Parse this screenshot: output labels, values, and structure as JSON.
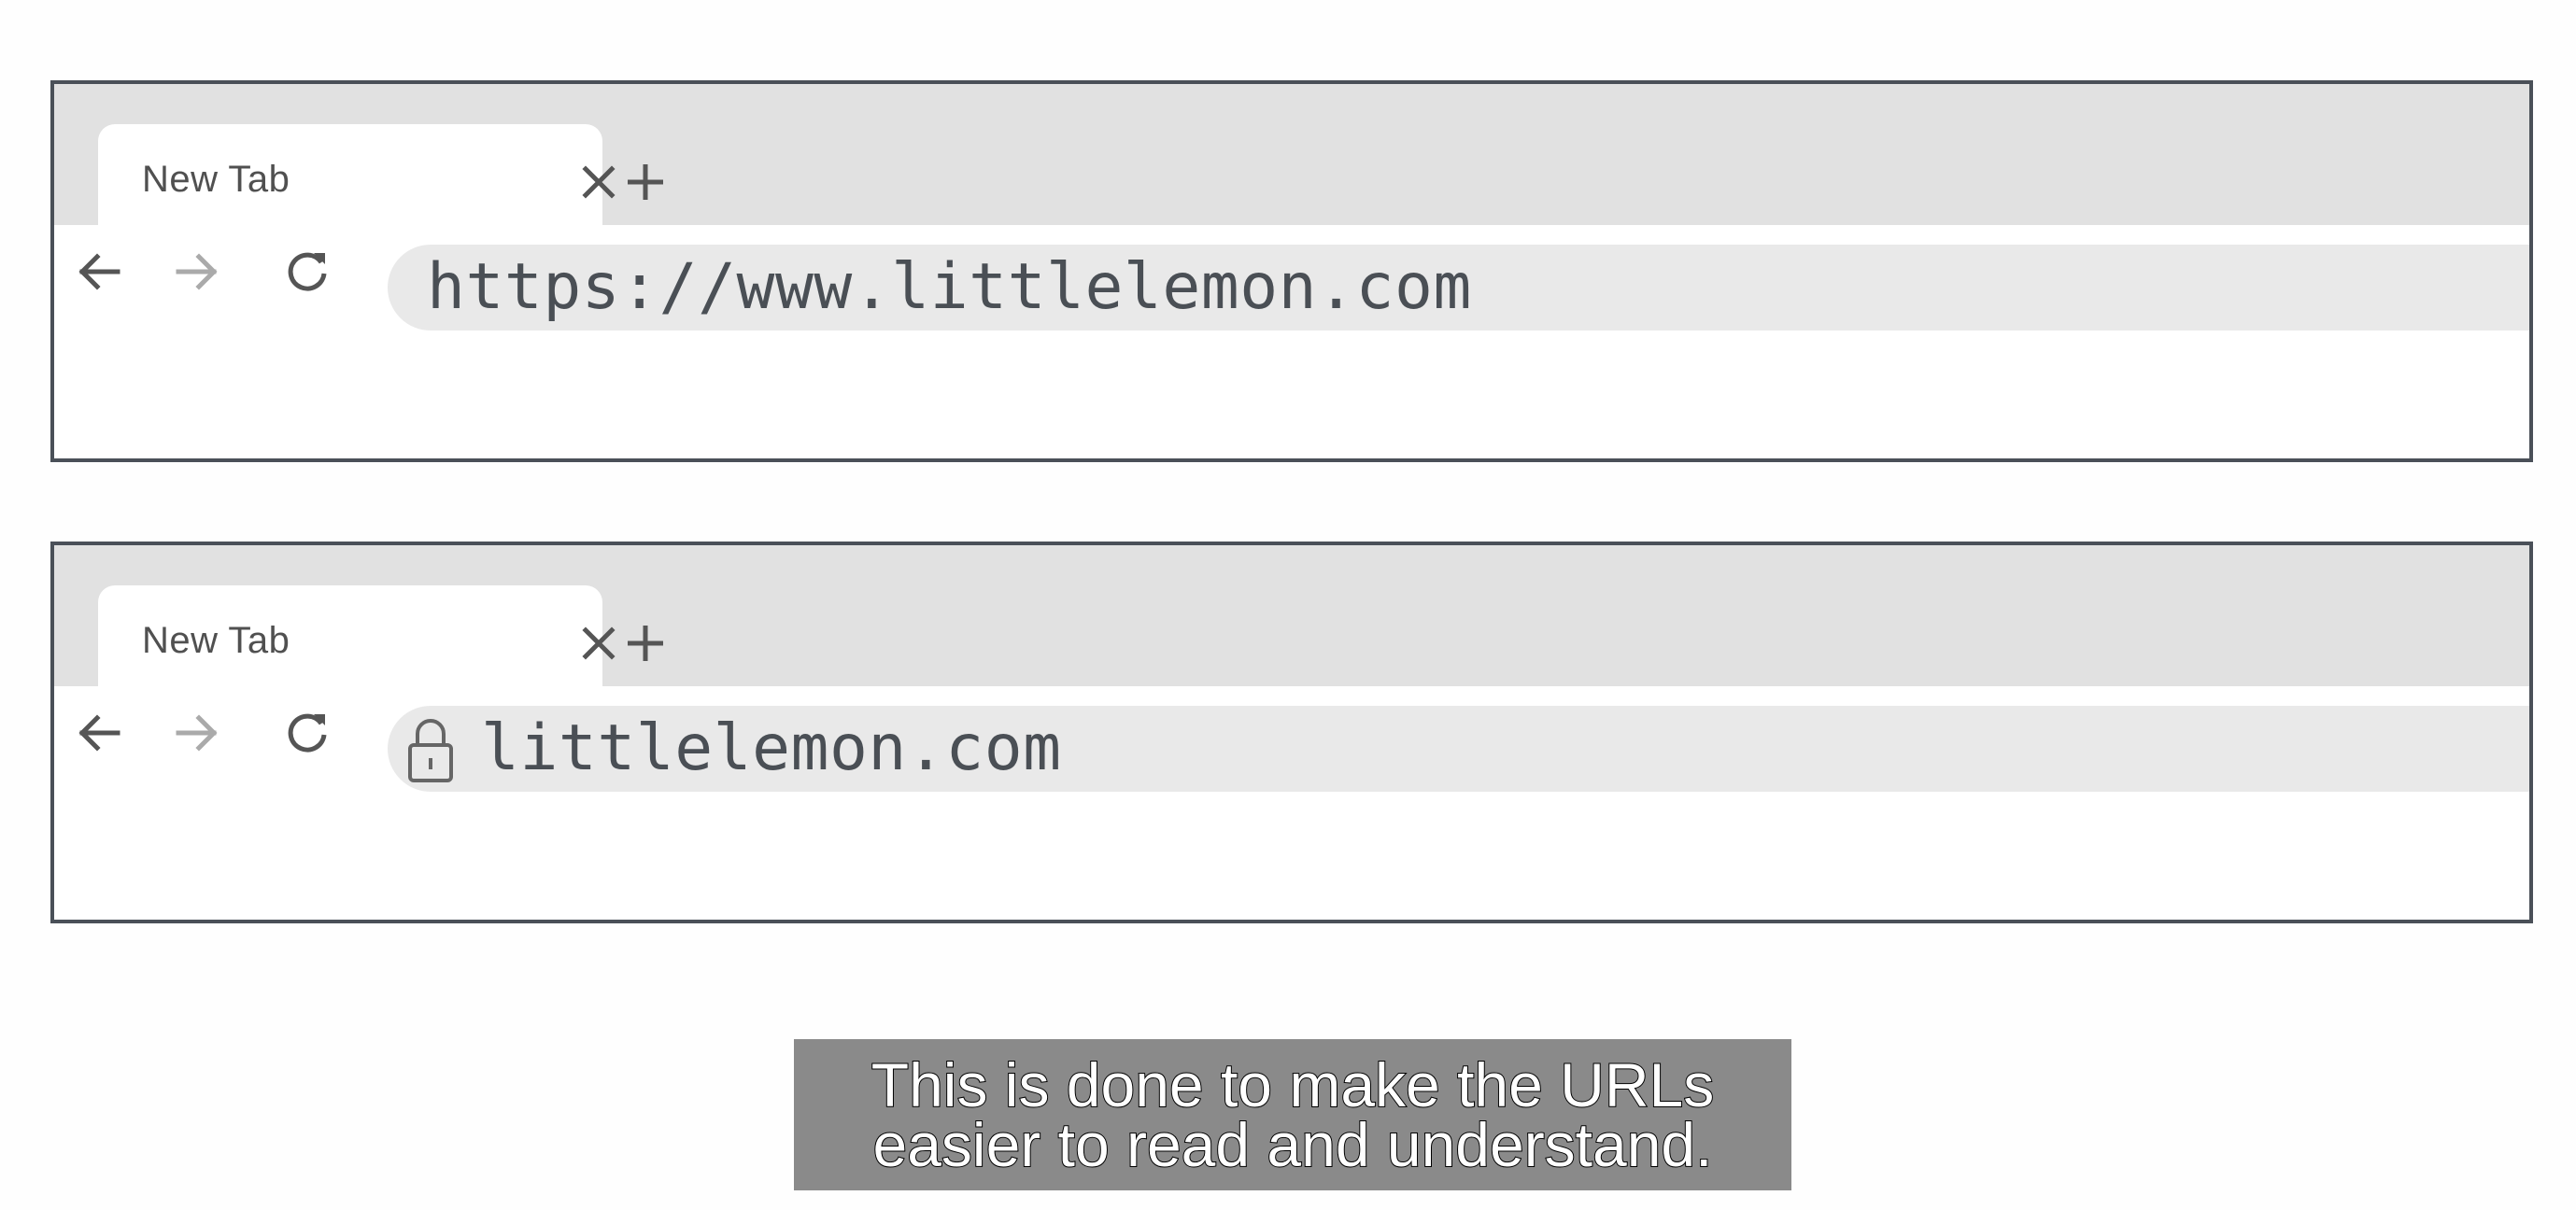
{
  "browsers": [
    {
      "tab": {
        "title": "New Tab",
        "close_icon": "close-icon"
      },
      "new_tab_icon": "plus-icon",
      "nav": {
        "back_icon": "arrow-left-icon",
        "forward_icon": "arrow-right-icon",
        "reload_icon": "reload-icon"
      },
      "address_bar": {
        "value": "https://www.littlelemon.com",
        "secure_icon": null
      }
    },
    {
      "tab": {
        "title": "New Tab",
        "close_icon": "close-icon"
      },
      "new_tab_icon": "plus-icon",
      "nav": {
        "back_icon": "arrow-left-icon",
        "forward_icon": "arrow-right-icon",
        "reload_icon": "reload-icon"
      },
      "address_bar": {
        "value": "littlelemon.com",
        "secure_icon": "lock-icon"
      }
    }
  ],
  "caption": {
    "line1": "This is done to make the URLs",
    "line2": "easier to read and understand."
  },
  "colors": {
    "frame_border": "#4a5058",
    "tab_strip": "#e1e1e1",
    "omnibox": "#e9e9e9",
    "caption_bg": "#8a8a8a"
  }
}
